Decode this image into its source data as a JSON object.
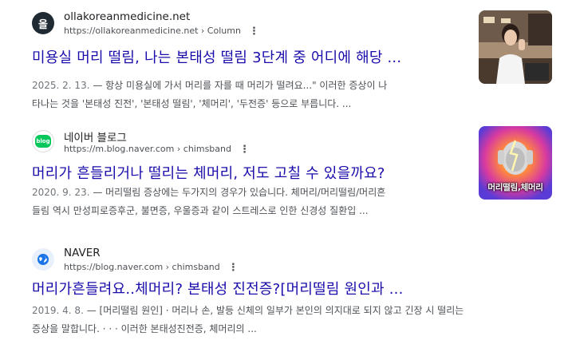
{
  "results": [
    {
      "site_name": "ollakoreanmedicine.net",
      "url": "https://ollakoreanmedicine.net › Column",
      "favicon_text": "올",
      "title": "미용실 머리 떨림, 나는 본태성 떨림 3단계 중 어디에 해당 ...",
      "date": "2025. 2. 13.",
      "snippet_line1": " — 항상 미용실에 가서 머리를 자를 때 머리가 떨려요...\" 이러한 증상이 나",
      "snippet_line2": "타나는 것을 '본태성 진전', '본태성 떨림', '체머리', '두전증' 등으로 부릅니다. ..."
    },
    {
      "site_name": "네이버 블로그",
      "url": "https://m.blog.naver.com › chimsband",
      "favicon_text": "blog",
      "title": "머리가 흔들리거나 떨리는 체머리, 저도 고칠 수 있을까요?",
      "date": "2020. 9. 23.",
      "snippet_line1": " — 머리떨림 증상에는 두가지의 경우가 있습니다. 체머리/머리떨림/머리흔",
      "snippet_line2": "들림 역시 만성피로증후군, 불면증, 우울증과 같이 스트레스로 인한 신경성 질환입 ...",
      "thumb_caption": "머리떨림,체머리"
    },
    {
      "site_name": "NAVER",
      "url": "https://blog.naver.com › chimsband",
      "title": "머리가흔들려요..체머리? 본태성 진전증?[머리떨림 원인과 ...",
      "date": "2019. 4. 8.",
      "snippet_line1": " — [머리떨림 원인] · 머리나 손, 발등 신체의 일부가 본인의 의지대로 되지 않고 긴장 시 떨리는",
      "snippet_line2": "증상을 말합니다. · · · 이러한 본태성진전증, 체머리의 ..."
    }
  ],
  "icons": {
    "more": "⋮",
    "globe": "globe-icon"
  },
  "colors": {
    "link": "#1a0dab",
    "naver_green": "#03c75a",
    "snippet": "#4d5156"
  }
}
